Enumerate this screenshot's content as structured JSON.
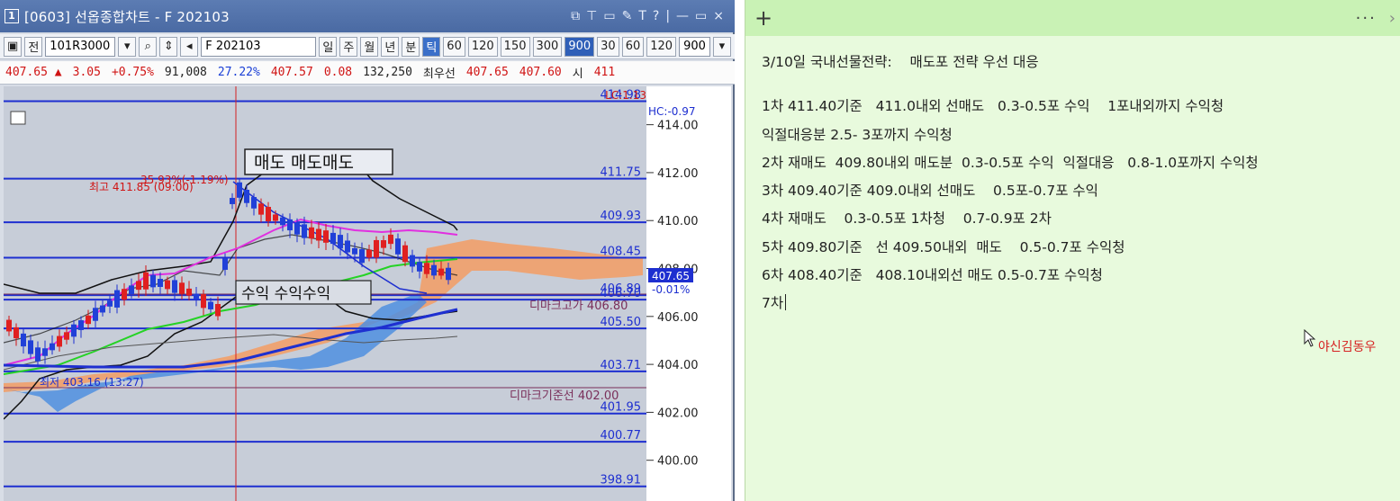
{
  "chart_window": {
    "window_number": "1",
    "title": "[0603] 선옵종합차트 - F 202103",
    "title_controls": [
      "⧉",
      "⊤",
      "▭",
      "✎",
      "T",
      "?",
      "|",
      "—",
      "▭",
      "×"
    ],
    "toolbar": {
      "prefix": "전",
      "code_value": "101R3000",
      "symbol_value": "F 202103",
      "periods": [
        "일",
        "주",
        "월",
        "년",
        "분",
        "틱"
      ],
      "intervals": [
        "60",
        "120",
        "150",
        "300",
        "900",
        "30",
        "60",
        "120",
        "900"
      ],
      "selected_interval": "900",
      "dropdown_value": "900"
    },
    "quote": {
      "price": "407.65 ▲",
      "change": "3.05",
      "change_pct": "+0.75%",
      "volume": "91,008",
      "volume_pct": "27.22%",
      "bid_price": "407.57",
      "bid_diff": "0.08",
      "open_interest": "132,250",
      "best_label": "최우선",
      "best_ask": "407.65",
      "best_bid": "407.60",
      "open_label": "시",
      "open_value": "411"
    },
    "chart_labels": {
      "sell_box": "매도 매도매도",
      "profit_box": "수익 수익수익",
      "high_marker": "최고 411.85 (09:00)",
      "high_pct": "35.93%(-1.19%)",
      "low_marker": "최저 403.16 (13:27)",
      "dimark_high": "디마크고가 406.80",
      "dimark_base": "디마크기준선 402.00",
      "lc_label": "LC:1.13",
      "hc_label": "HC:-0.97",
      "current_price_tag": "407.65",
      "current_pct_tag": "-0.01%"
    },
    "chart_data": {
      "type": "line",
      "price_axis_ticks": [
        "414.00",
        "412.00",
        "410.00",
        "408.00",
        "406.00",
        "404.00",
        "402.00",
        "400.00"
      ],
      "horizontal_levels": [
        "414.98",
        "411.75",
        "409.93",
        "408.45",
        "406.89",
        "406.70",
        "405.50",
        "403.71",
        "401.95",
        "400.77",
        "398.91"
      ],
      "ylim": [
        398.3,
        415.6
      ]
    }
  },
  "memo": {
    "add_icon": "+",
    "more_icon": "···",
    "title": "3/10일 국내선물전략:    매도포 전략 우선 대응",
    "lines": [
      "1차 411.40기준   411.0내외 선매도   0.3-0.5포 수익    1포내외까지 수익청",
      "익절대응분 2.5- 3포까지 수익청",
      "2차 재매도  409.80내외 매도분  0.3-0.5포 수익  익절대응   0.8-1.0포까지 수익청",
      "3차 409.40기준 409.0내외 선매도    0.5포-0.7포 수익",
      "4차 재매도    0.3-0.5포 1차청    0.7-0.9포 2차",
      "5차 409.80기준   선 409.50내외  매도    0.5-0.7포 수익청",
      "6차 408.40기준   408.10내외선 매도 0.5-0.7포 수익청",
      "7차"
    ],
    "cursor_note": "야신김동우"
  }
}
